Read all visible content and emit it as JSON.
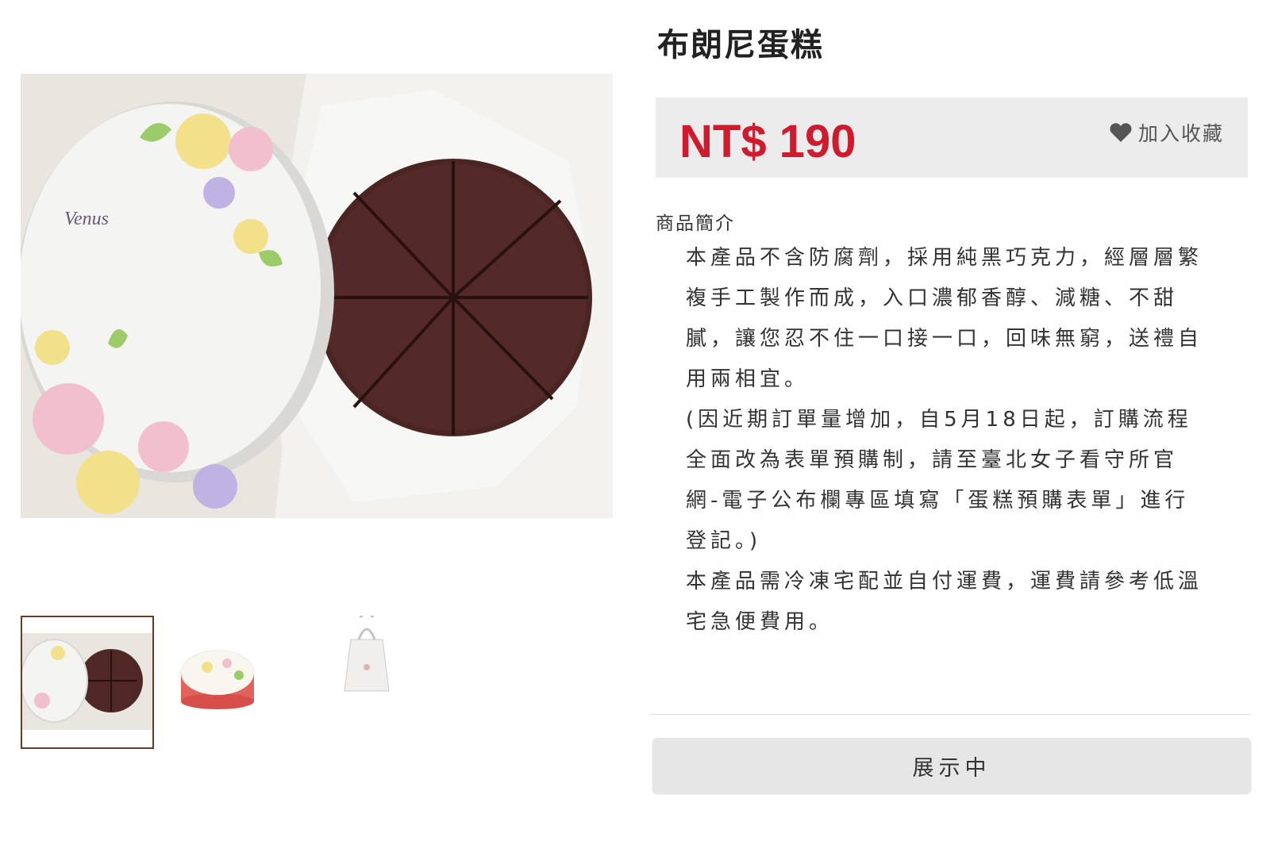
{
  "product": {
    "title": "布朗尼蛋糕",
    "price": "NT$ 190",
    "favorite_label": "加入收藏",
    "description_label": "商品簡介",
    "description": [
      "本產品不含防腐劑，採用純黑巧克力，經層層繁",
      "複手工製作而成，入口濃郁香醇、減糖、不甜",
      "膩，讓您忍不住一口接一口，回味無窮，送禮自",
      "用兩相宜。",
      "(因近期訂單量增加，自5月18日起，訂購流程",
      "全面改為表單預購制，請至臺北女子看守所官",
      "網-電子公布欄專區填寫「蛋糕預購表單」進行",
      "登記。)",
      "本產品需冷凍宅配並自付運費，運費請參考低溫",
      "宅急便費用。"
    ],
    "status_button": "展示中",
    "box_brand": "Venus",
    "colors": {
      "price": "#d01a2e",
      "price_box": "#ececec",
      "thumb_border": "#6a3a2a"
    }
  },
  "gallery": {
    "images": [
      "brownie-cake-in-floral-box",
      "floral-gift-box",
      "white-gift-bag"
    ],
    "active_index": 0
  }
}
